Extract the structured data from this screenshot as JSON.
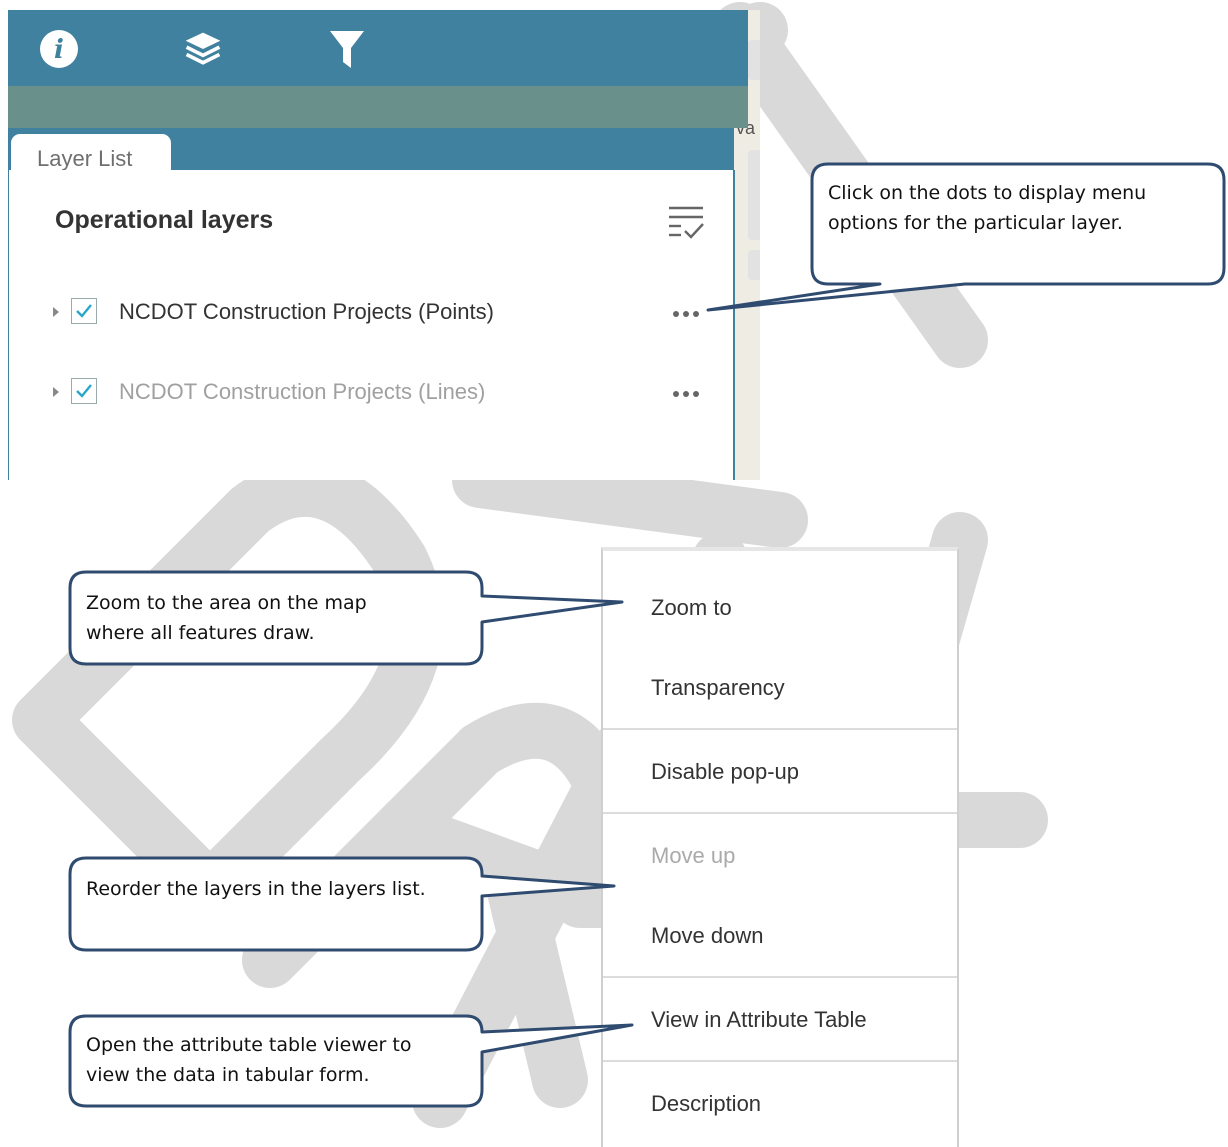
{
  "watermark": {
    "text": "DRAFT",
    "color": "#d9d9d9"
  },
  "panel": {
    "toolbar": {
      "icons": [
        "info-icon",
        "layers-icon",
        "filter-icon"
      ],
      "color": "#3f819f"
    },
    "map_text": "va",
    "tab_label": "Layer List",
    "heading": "Operational layers",
    "layers": [
      {
        "name": "NCDOT Construction Projects (Points)",
        "checked": true,
        "active": true
      },
      {
        "name": "NCDOT Construction Projects (Lines)",
        "checked": true,
        "active": false
      }
    ],
    "options_icon": "layer-options-icon",
    "more_icon": "more-dots-icon"
  },
  "menu": {
    "items": [
      {
        "label": "Zoom to",
        "disabled": false
      },
      {
        "label": "Transparency",
        "disabled": false
      },
      {
        "label": "Disable pop-up",
        "disabled": false
      },
      {
        "label": "Move up",
        "disabled": true
      },
      {
        "label": "Move down",
        "disabled": false
      },
      {
        "label": "View in Attribute Table",
        "disabled": false
      },
      {
        "label": "Description",
        "disabled": false
      }
    ]
  },
  "callouts": {
    "dots": {
      "line1": "Click on the dots to display menu",
      "line2": "options for the particular layer."
    },
    "zoom": {
      "line1": "Zoom to the area on the map",
      "line2": "where all features draw."
    },
    "reorder": {
      "line1": "Reorder the layers in the layers list."
    },
    "attribute": {
      "line1": "Open the attribute table viewer to",
      "line2": "view the data in tabular form."
    }
  },
  "colors": {
    "accent": "#3f819f",
    "band": "#69908b",
    "callout_border": "#2f4b6f",
    "check": "#2aa6c8"
  }
}
